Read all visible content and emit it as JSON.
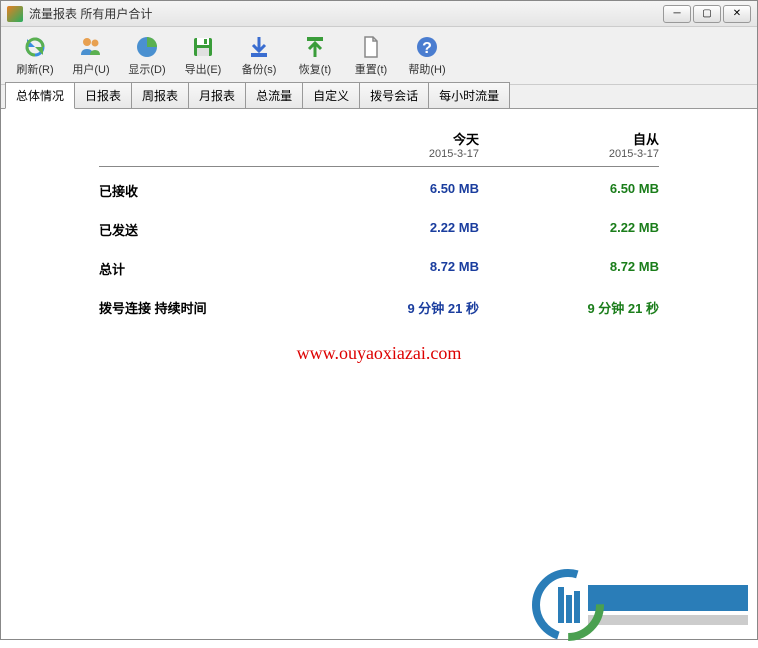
{
  "window": {
    "title": "流量报表 所有用户合计"
  },
  "toolbar": {
    "refresh": "刷新(R)",
    "users": "用户(U)",
    "display": "显示(D)",
    "export": "导出(E)",
    "backup": "备份(s)",
    "restore": "恢复(t)",
    "reset": "重置(t)",
    "help": "帮助(H)"
  },
  "tabs": {
    "overview": "总体情况",
    "daily": "日报表",
    "weekly": "周报表",
    "monthly": "月报表",
    "total": "总流量",
    "custom": "自定义",
    "dialup": "拨号会话",
    "hourly": "每小时流量"
  },
  "report": {
    "headers": {
      "today": "今天",
      "today_date": "2015-3-17",
      "since": "自从",
      "since_date": "2015-3-17"
    },
    "rows": {
      "received": {
        "label": "已接收",
        "today": "6.50 MB",
        "since": "6.50 MB"
      },
      "sent": {
        "label": "已发送",
        "today": "2.22 MB",
        "since": "2.22 MB"
      },
      "total": {
        "label": "总计",
        "today": "8.72 MB",
        "since": "8.72 MB"
      },
      "duration": {
        "label": "拨号连接 持续时间",
        "today": "9 分钟 21 秒",
        "since": "9 分钟 21 秒"
      }
    }
  },
  "watermark": "www.ouyaoxiazai.com"
}
